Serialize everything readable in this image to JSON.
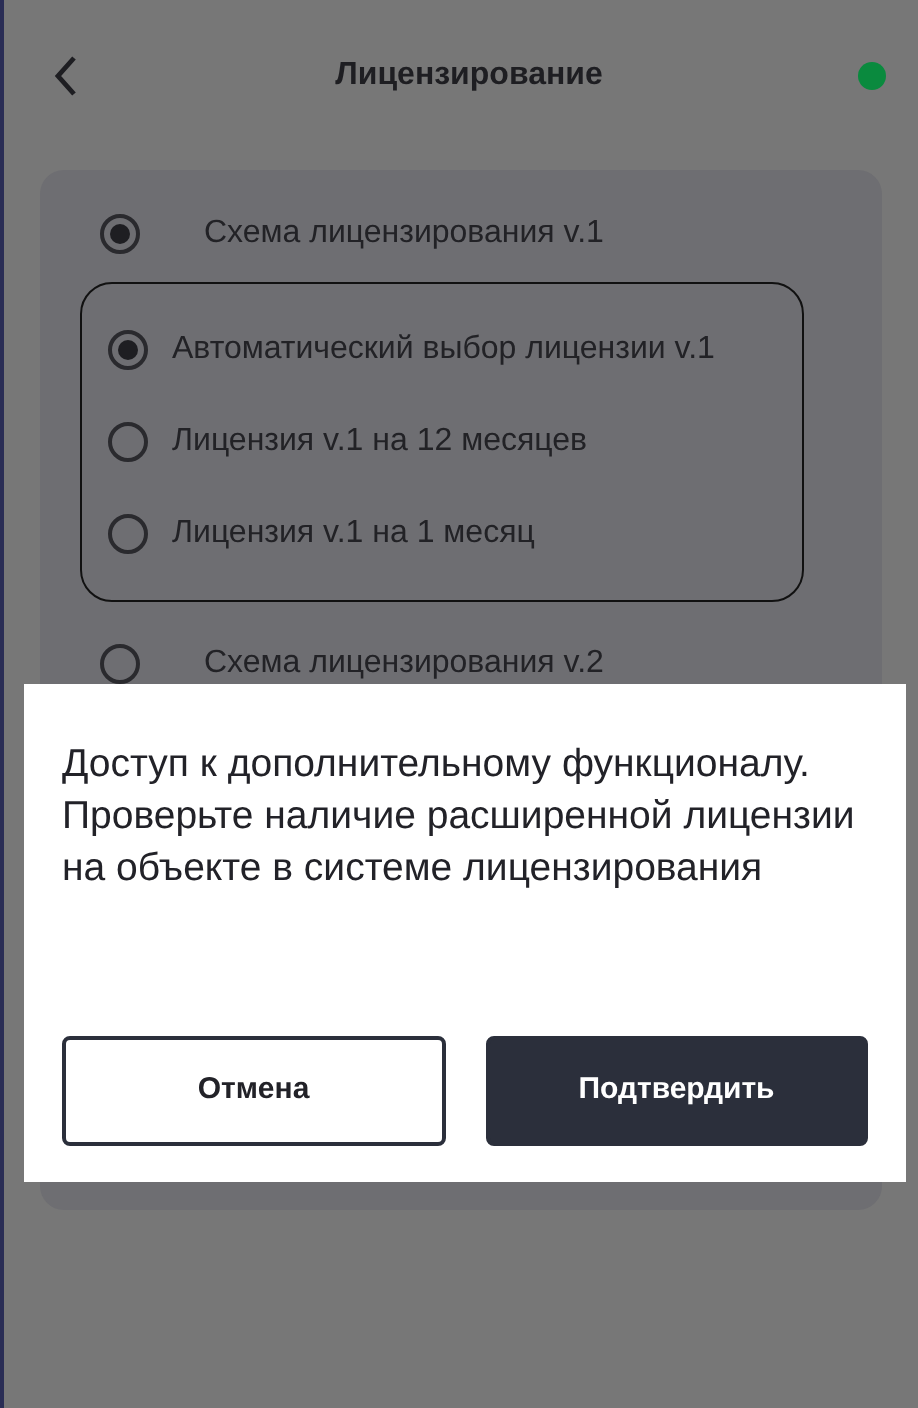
{
  "header": {
    "title": "Лицензирование",
    "connected": true
  },
  "schemes": [
    {
      "label": "Схема лицензирования v.1",
      "selected": true,
      "options": [
        {
          "label": "Автоматический выбор лицензии v.1",
          "selected": true
        },
        {
          "label": "Лицензия v.1 на 12 месяцев",
          "selected": false
        },
        {
          "label": "Лицензия v.1 на 1 месяц",
          "selected": false
        }
      ]
    },
    {
      "label": "Схема лицензирования v.2",
      "selected": false
    }
  ],
  "dialog": {
    "message": "Доступ к дополнительному функционалу. Проверьте наличие расширенной лицензии на объекте в системе лицензирования",
    "buttons": [
      {
        "label": "Отмена",
        "kind": "secondary"
      },
      {
        "label": "Подтвердить",
        "kind": "primary"
      }
    ]
  }
}
